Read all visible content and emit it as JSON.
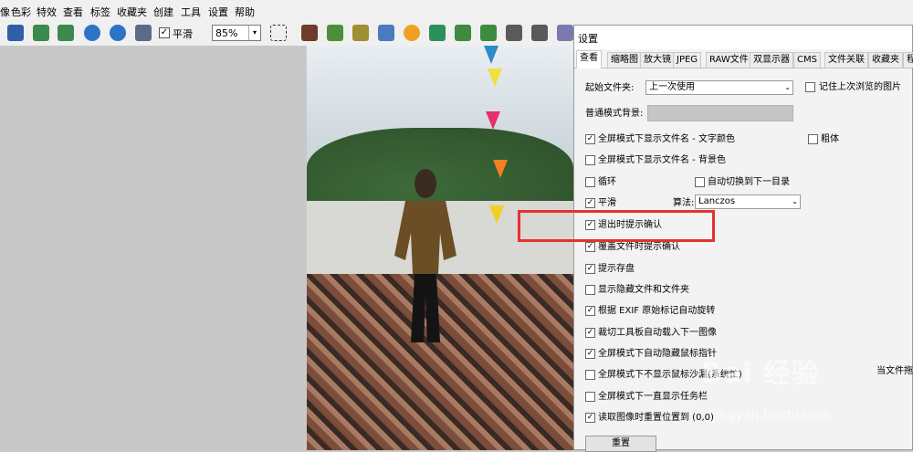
{
  "menu": [
    "像",
    "色彩",
    "特效",
    "查看",
    "标签",
    "收藏夹",
    "创建",
    "工具",
    "设置",
    "帮助"
  ],
  "toolbar": {
    "smooth_label": "平滑",
    "smooth_checked": "✓",
    "zoom": "85%",
    "zoom_arrow": "▾"
  },
  "dialog": {
    "title": "设置",
    "tabs": [
      "查看",
      "缩略图",
      "放大镜",
      "JPEG",
      "RAW文件",
      "双显示器",
      "CMS",
      "文件关联",
      "收藏夹",
      "程"
    ],
    "start_folder_label": "起始文件夹:",
    "start_folder_value": "上一次使用",
    "remember_label": "记住上次浏览的图片",
    "bg_label": "普通模式背景:",
    "fs_filename_text_label": "全屏模式下显示文件名 - 文字颜色",
    "bold_label": "粗体",
    "fs_filename_bg_label": "全屏模式下显示文件名 - 背景色",
    "loop_label": "循环",
    "auto_next_dir_label": "自动切换到下一目录",
    "smooth_label": "平滑",
    "algorithm_label": "算法:",
    "algorithm_value": "Lanczos",
    "confirm_exit_label": "退出时提示确认",
    "confirm_overwrite_label": "覆盖文件时提示确认",
    "prompt_save_label": "提示存盘",
    "show_hidden_label": "显示隐藏文件和文件夹",
    "exif_rotate_label": "根据 EXIF 原始标记自动旋转",
    "crop_autoload_label": "裁切工具板自动载入下一图像",
    "fs_hide_cursor_label": "全屏模式下自动隐藏鼠标指针",
    "fs_no_hourglass_label": "全屏模式下不显示鼠标沙漏(系统忙)",
    "fs_taskbar_label": "全屏模式下一直显示任务栏",
    "reset_pos_label": "读取图像时重置位置到 (0,0)",
    "reset_button": "重置",
    "side_note": "当文件拖",
    "check": "✓",
    "dropdown_arrow": "⌄"
  },
  "watermark": {
    "brand": "Bai 经验",
    "url": "jingyan.baidu.com"
  },
  "colors": {
    "highlight": "#e5312f",
    "dialog_bg": "#f3f3f3",
    "canvas_bg": "#c8c8c8"
  }
}
